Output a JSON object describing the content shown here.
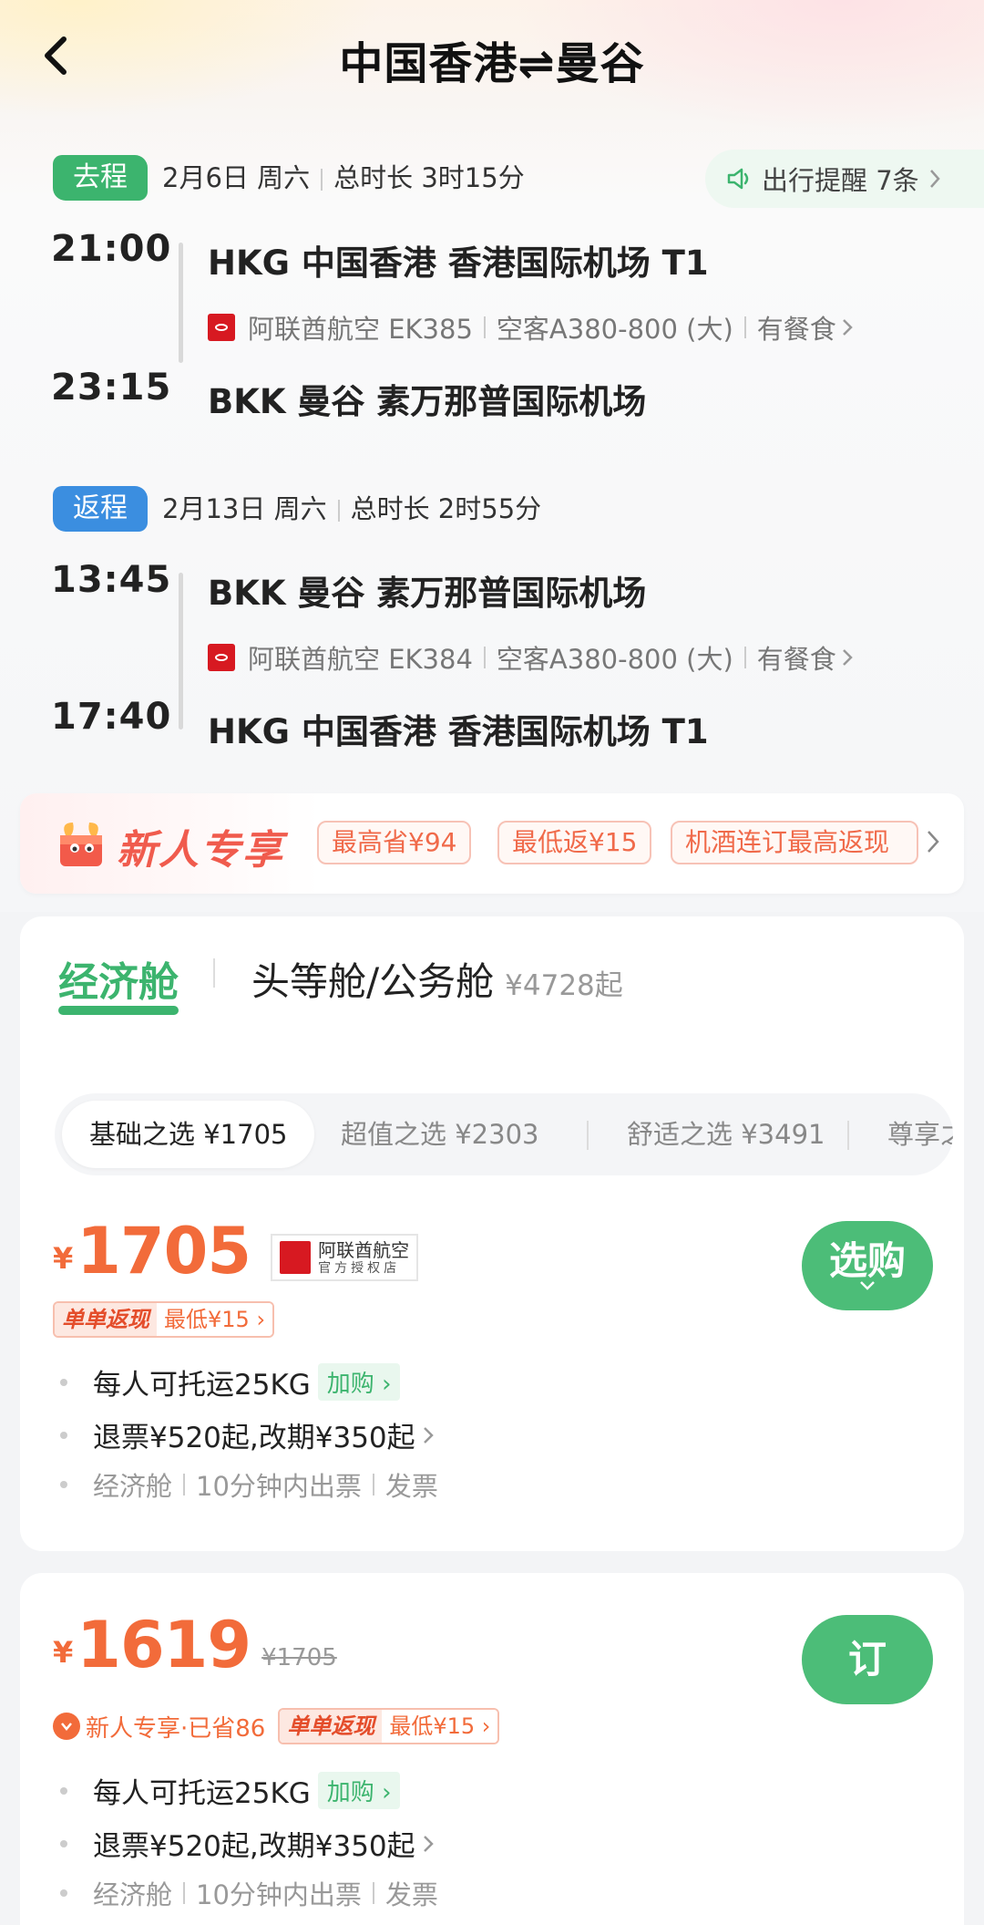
{
  "header": {
    "title": "中国香港⇌曼谷"
  },
  "outbound": {
    "tag": "去程",
    "date": "2月6日 周六",
    "duration": "总时长 3时15分",
    "reminder": "出行提醒 7条",
    "dep_time": "21:00",
    "dep_airport": "HKG 中国香港 香港国际机场 T1",
    "airline": "阿联酋航空 EK385",
    "aircraft": "空客A380-800 (大)",
    "meal": "有餐食",
    "arr_time": "23:15",
    "arr_airport": "BKK 曼谷 素万那普国际机场"
  },
  "inbound": {
    "tag": "返程",
    "date": "2月13日 周六",
    "duration": "总时长 2时55分",
    "dep_time": "13:45",
    "dep_airport": "BKK 曼谷 素万那普国际机场",
    "airline": "阿联酋航空 EK384",
    "aircraft": "空客A380-800 (大)",
    "meal": "有餐食",
    "arr_time": "17:40",
    "arr_airport": "HKG 中国香港 香港国际机场 T1"
  },
  "promo": {
    "title": "新人专享",
    "chips": [
      "最高省¥94",
      "最低返¥15",
      "机酒连订最高返现"
    ]
  },
  "cabin": {
    "economy": "经济舱",
    "business": "头等舱/公务舱",
    "business_from": "¥4728起"
  },
  "subtabs": [
    "基础之选  ¥1705",
    "超值之选  ¥2303",
    "舒适之选  ¥3491",
    "尊享之选"
  ],
  "offer1": {
    "yen": "¥",
    "price": "1705",
    "store_name": "阿联酋航空",
    "store_sub": "官方授权店",
    "button": "选购",
    "cashback_key": "单单返现",
    "cashback_val": "最低¥15",
    "baggage": "每人可托运25KG",
    "addon": "加购",
    "refund": "退票¥520起,改期¥350起",
    "info": [
      "经济舱",
      "10分钟内出票",
      "发票"
    ]
  },
  "offer2": {
    "yen": "¥",
    "price": "1619",
    "old_price": "¥1705",
    "button": "订",
    "newbie": "新人专享·已省86",
    "cashback_key": "单单返现",
    "cashback_val": "最低¥15",
    "baggage": "每人可托运25KG",
    "addon": "加购",
    "refund": "退票¥520起,改期¥350起",
    "info": [
      "经济舱",
      "10分钟内出票",
      "发票"
    ]
  },
  "colors": {
    "green": "#3cb46e",
    "blue": "#3b8ee0",
    "orange": "#f26b3a",
    "emirates_red": "#d71921"
  },
  "icons": [
    "back-chevron-icon",
    "speaker-icon",
    "chevron-right-icon",
    "emirates-logo-icon",
    "mascot-icon",
    "chevron-down-icon",
    "newbie-coupon-icon"
  ]
}
